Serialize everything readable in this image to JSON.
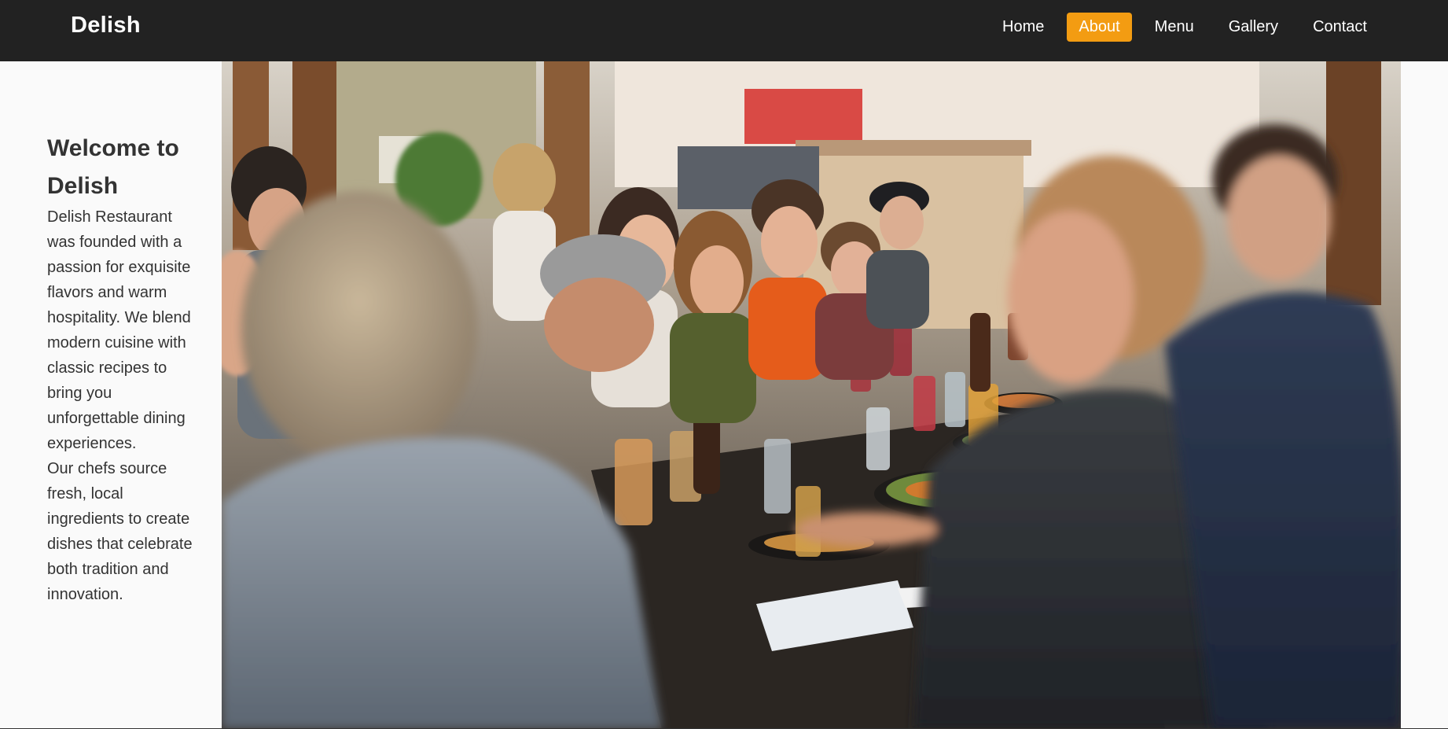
{
  "brand": "Delish",
  "nav": {
    "home": "Home",
    "about": "About",
    "menu": "Menu",
    "gallery": "Gallery",
    "contact": "Contact",
    "active": "About"
  },
  "about": {
    "title": "Welcome to Delish",
    "paragraph1": "Delish Restaurant was founded with a passion for exquisite flavors and warm hospitality. We blend modern cuisine with classic recipes to bring you unforgettable dining experiences.",
    "paragraph2": "Our chefs source fresh, local ingredients to create dishes that celebrate both tradition and innovation."
  },
  "colors": {
    "navbar_bg": "#222222",
    "accent": "#f39c12",
    "text": "#333333",
    "page_bg": "#fafafa"
  }
}
